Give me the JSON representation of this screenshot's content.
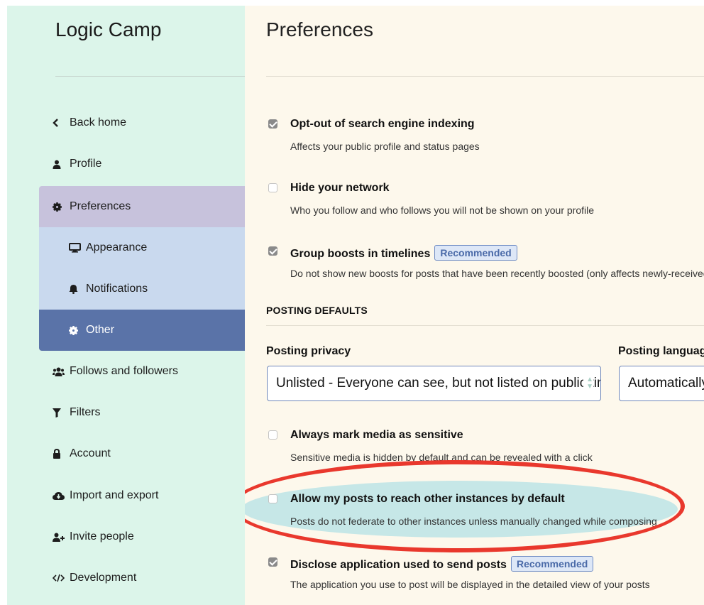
{
  "sidebar": {
    "brand": "Logic Camp",
    "items": [
      {
        "label": "Back home",
        "icon": "chevron-left-icon"
      },
      {
        "label": "Profile",
        "icon": "user-icon"
      },
      {
        "label": "Preferences",
        "icon": "gear-icon"
      },
      {
        "label": "Appearance",
        "icon": "desktop-icon"
      },
      {
        "label": "Notifications",
        "icon": "bell-icon"
      },
      {
        "label": "Other",
        "icon": "gear-icon"
      },
      {
        "label": "Follows and followers",
        "icon": "users-icon"
      },
      {
        "label": "Filters",
        "icon": "filter-icon"
      },
      {
        "label": "Account",
        "icon": "lock-icon"
      },
      {
        "label": "Import and export",
        "icon": "cloud-download-icon"
      },
      {
        "label": "Invite people",
        "icon": "user-plus-icon"
      },
      {
        "label": "Development",
        "icon": "code-icon"
      }
    ]
  },
  "main": {
    "title": "Preferences",
    "options": [
      {
        "label": "Opt-out of search engine indexing",
        "hint": "Affects your public profile and status pages",
        "checked": true
      },
      {
        "label": "Hide your network",
        "hint": "Who you follow and who follows you will not be shown on your profile",
        "checked": false
      },
      {
        "label": "Group boosts in timelines",
        "badge": "Recommended",
        "hint": "Do not show new boosts for posts that have been recently boosted (only affects newly-received boosts)",
        "checked": true
      }
    ],
    "posting_defaults": {
      "heading": "POSTING DEFAULTS",
      "privacy_label": "Posting privacy",
      "privacy_value": "Unlisted - Everyone can see, but not listed on public timelines",
      "language_label": "Posting language",
      "language_value": "Automatically detect"
    },
    "options2": [
      {
        "label": "Always mark media as sensitive",
        "hint": "Sensitive media is hidden by default and can be revealed with a click",
        "checked": false
      },
      {
        "label": "Allow my posts to reach other instances by default",
        "hint": "Posts do not federate to other instances unless manually changed while composing",
        "checked": false
      },
      {
        "label": "Disclose application used to send posts",
        "badge": "Recommended",
        "hint": "The application you use to post will be displayed in the detailed view of your posts",
        "checked": true
      }
    ]
  },
  "colors": {
    "sidebar_bg": "#dcf5ea",
    "main_bg": "#fdf8ec",
    "active_item": "#5a73a8",
    "annotation": "#e9382d"
  }
}
